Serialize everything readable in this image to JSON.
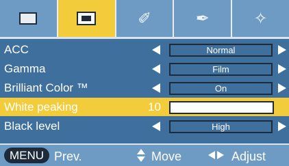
{
  "tabs": [
    {
      "icon": "picture-monitor-icon",
      "active": false
    },
    {
      "icon": "screen-monitor-icon",
      "active": true
    },
    {
      "icon": "tool-icon",
      "active": false
    },
    {
      "icon": "settings-tool-icon",
      "active": false
    },
    {
      "icon": "network-icon",
      "active": false
    }
  ],
  "menu": {
    "rows": [
      {
        "label": "ACC",
        "value": "Normal"
      },
      {
        "label": "Gamma",
        "value": "Film"
      },
      {
        "label": "Brilliant Color ™",
        "value": "On"
      },
      {
        "label": "White peaking",
        "level": "10",
        "fraction": 0.0
      },
      {
        "label": "Black level",
        "value": "High"
      }
    ],
    "selected_index": 3
  },
  "footer": {
    "menu_key": "MENU",
    "prev_label": "Prev.",
    "move_label": "Move",
    "adjust_label": "Adjust"
  },
  "colors": {
    "background": "#3f6f9c",
    "tab_bar": "#6e9bc3",
    "highlight": "#f2cc3a",
    "text": "#ffffff",
    "outline": "#1c2a3a"
  }
}
